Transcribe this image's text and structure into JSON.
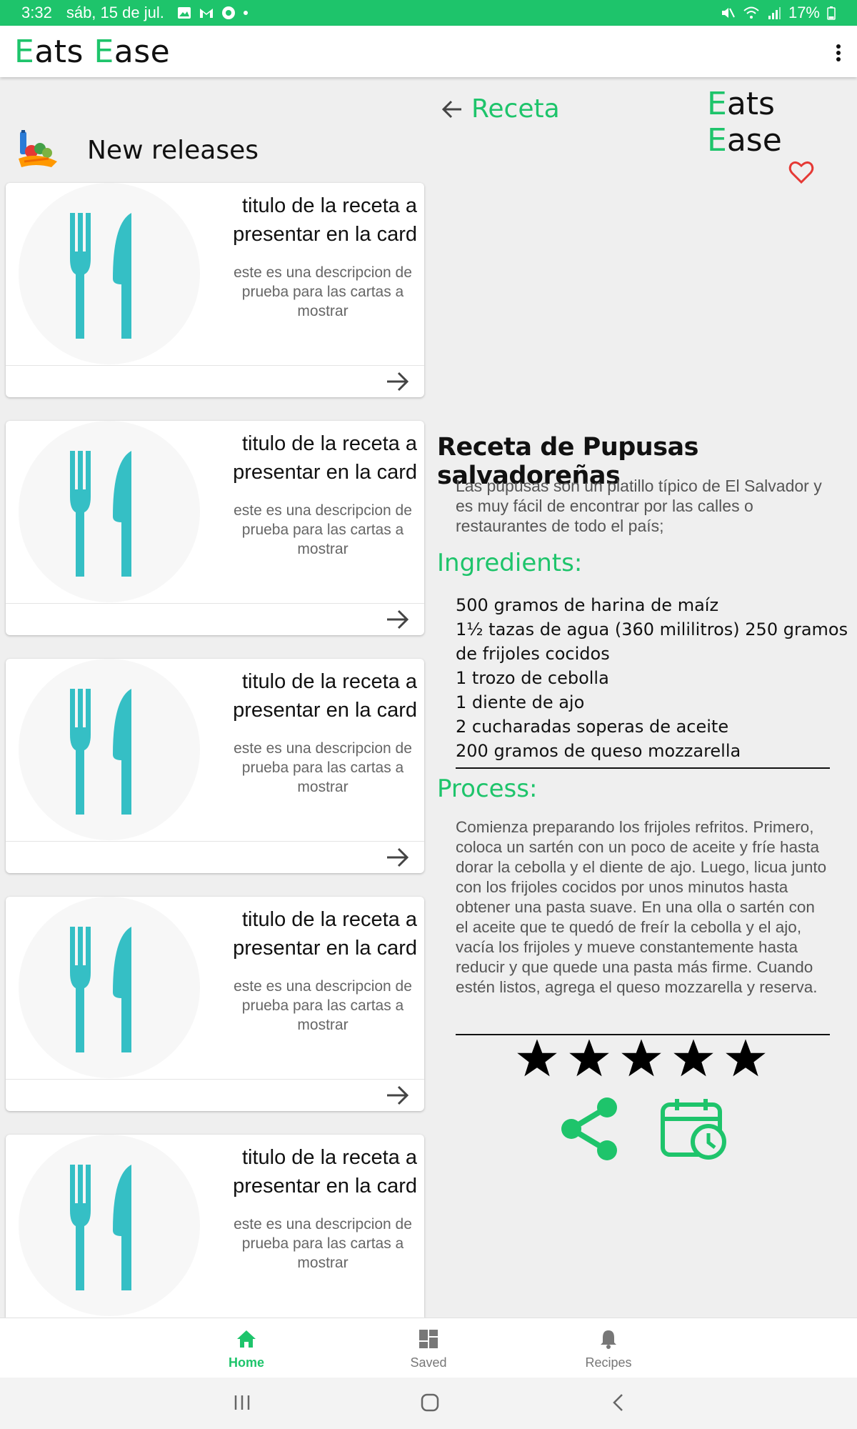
{
  "status_bar": {
    "time": "3:32",
    "date": "sáb, 15 de jul.",
    "battery": "17%"
  },
  "app_bar": {
    "brand_first_letter": "E",
    "brand_word1_rest": "ats ",
    "brand_second_letter": "E",
    "brand_word2_rest": "ase"
  },
  "left_panel": {
    "title": "New releases",
    "cards": [
      {
        "title": "titulo de la receta a presentar en la card",
        "description": "este es una descripcion de prueba para las cartas a mostrar"
      },
      {
        "title": "titulo de la receta a presentar en la card",
        "description": "este es una descripcion de prueba para las cartas a mostrar"
      },
      {
        "title": "titulo de la receta a presentar en la card",
        "description": "este es una descripcion de prueba para las cartas a mostrar"
      },
      {
        "title": "titulo de la receta a presentar en la card",
        "description": "este es una descripcion de prueba para las cartas a mostrar"
      },
      {
        "title": "titulo de la receta a presentar en la card",
        "description": "este es una descripcion de prueba para las cartas a mostrar"
      }
    ]
  },
  "detail": {
    "back_label": "Receta",
    "recipe_title": "Receta de Pupusas salvadoreñas",
    "recipe_description": "Las pupusas son un platillo típico de El Salvador y es muy fácil de encontrar por las calles o restaurantes de todo el país;",
    "ingredients_heading": "Ingredients:",
    "ingredients": [
      "500 gramos de harina de maíz",
      " 1½ tazas de agua (360 mililitros) 250 gramos",
      "de frijoles cocidos",
      " 1 trozo de cebolla",
      " 1 diente de ajo",
      " 2 cucharadas soperas de aceite",
      " 200 gramos de queso mozzarella"
    ],
    "process_heading": "Process:",
    "process_text": "Comienza preparando los frijoles refritos. Primero, coloca un sartén con un poco de aceite y fríe hasta dorar la cebolla y el diente de ajo. Luego, licua junto con los frijoles cocidos por unos minutos hasta obtener una pasta suave.  En una olla o sartén con el aceite que te quedó de freír la cebolla y el ajo, vacía los frijoles y mueve constantemente hasta reducir y que quede una pasta más firme. Cuando estén listos, agrega el queso mozzarella y reserva.",
    "rating": 5
  },
  "bottom_nav": {
    "items": [
      {
        "label": "Home",
        "icon": "home-icon",
        "active": true
      },
      {
        "label": "Saved",
        "icon": "dashboard-icon",
        "active": false
      },
      {
        "label": "Recipes",
        "icon": "bell-icon",
        "active": false
      }
    ]
  },
  "colors": {
    "accent": "#1ec46b",
    "icon_teal": "#35bfc5",
    "heart": "#e53935"
  }
}
